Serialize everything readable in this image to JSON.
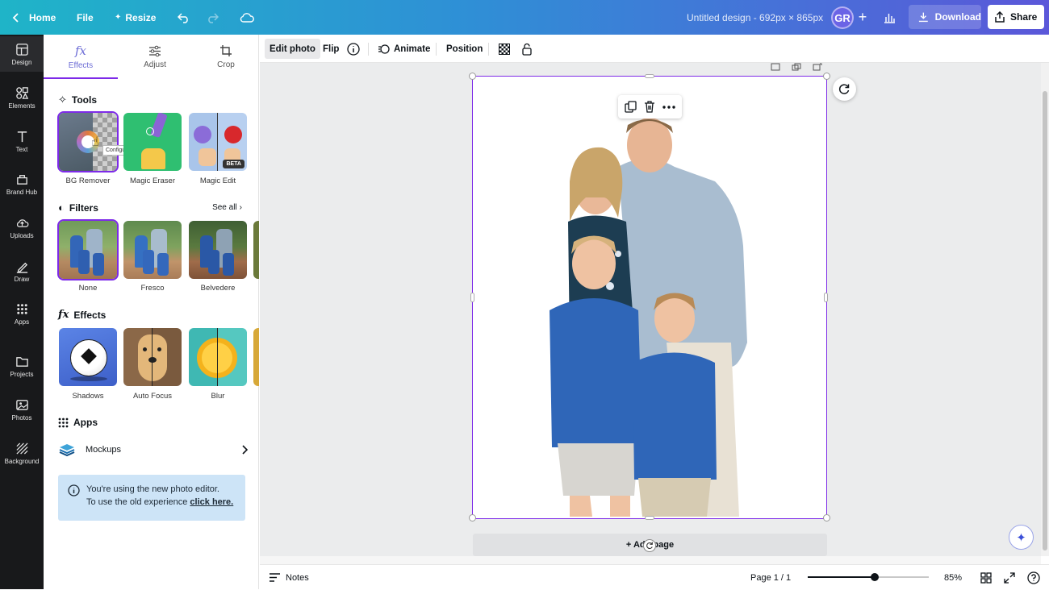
{
  "topbar": {
    "home": "Home",
    "file": "File",
    "resize": "Resize",
    "design_title": "Untitled design - 692px × 865px",
    "avatar_initials": "GR",
    "download": "Download",
    "share": "Share"
  },
  "leftnav": {
    "items": [
      {
        "label": "Design",
        "icon": "design-icon"
      },
      {
        "label": "Elements",
        "icon": "elements-icon"
      },
      {
        "label": "Text",
        "icon": "text-icon"
      },
      {
        "label": "Brand Hub",
        "icon": "brand-hub-icon"
      },
      {
        "label": "Uploads",
        "icon": "uploads-icon"
      },
      {
        "label": "Draw",
        "icon": "draw-icon"
      },
      {
        "label": "Apps",
        "icon": "apps-icon"
      },
      {
        "label": "Projects",
        "icon": "projects-icon"
      },
      {
        "label": "Photos",
        "icon": "photos-icon"
      },
      {
        "label": "Background",
        "icon": "background-icon"
      }
    ]
  },
  "panel": {
    "tabs": [
      {
        "label": "Effects",
        "icon": "fx-icon"
      },
      {
        "label": "Adjust",
        "icon": "sliders-icon"
      },
      {
        "label": "Crop",
        "icon": "crop-icon"
      }
    ],
    "tools": {
      "heading": "Tools",
      "tooltip": "Configure...",
      "items": [
        {
          "label": "BG Remover"
        },
        {
          "label": "Magic Eraser"
        },
        {
          "label": "Magic Edit",
          "badge": "BETA"
        }
      ]
    },
    "filters": {
      "heading": "Filters",
      "see_all": "See all",
      "items": [
        {
          "label": "None"
        },
        {
          "label": "Fresco"
        },
        {
          "label": "Belvedere"
        }
      ]
    },
    "effects": {
      "heading": "Effects",
      "items": [
        {
          "label": "Shadows"
        },
        {
          "label": "Auto Focus"
        },
        {
          "label": "Blur"
        }
      ]
    },
    "apps": {
      "heading": "Apps",
      "mockups": "Mockups"
    },
    "info": {
      "line1": "You're using the new photo editor.",
      "line2_prefix": "To use the old experience ",
      "link": "click here."
    }
  },
  "toolbar": {
    "edit_photo": "Edit photo",
    "flip": "Flip",
    "animate": "Animate",
    "position": "Position"
  },
  "canvas": {
    "add_page": "+ Add page"
  },
  "bottombar": {
    "notes": "Notes",
    "page_indicator": "Page 1 / 1",
    "zoom": "85%",
    "zoom_fraction": 0.55
  },
  "colors": {
    "accent": "#7d2ae8",
    "nav_bg": "#18191b",
    "info_bg": "#cde4f7"
  }
}
